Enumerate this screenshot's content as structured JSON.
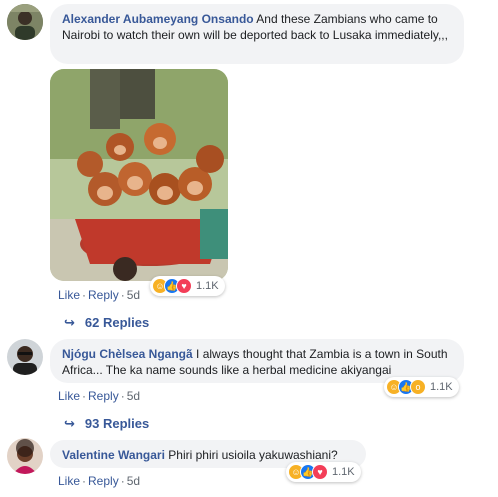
{
  "comments": [
    {
      "author": "Alexander Aubameyang Onsando",
      "text": "And these Zambians who came to Nairobi to watch their own will be deported back to Lusaka immediately,,,",
      "actions": {
        "like": "Like",
        "reply": "Reply",
        "time": "5d"
      },
      "reaction_count": "1.1K",
      "replies": "62 Replies"
    },
    {
      "author": "Njógu Chèlsea Ngangã",
      "text": "I always thought that Zambia is a town in South Africa... The ka name sounds like a herbal medicine akiyangai",
      "actions": {
        "like": "Like",
        "reply": "Reply",
        "time": "5d"
      },
      "reaction_count": "1.1K",
      "replies": "93 Replies"
    },
    {
      "author": "Valentine Wangari",
      "text": "Phiri phiri usioila yakuwashiani?",
      "actions": {
        "like": "Like",
        "reply": "Reply",
        "time": "5d"
      },
      "reaction_count": "1.1K"
    }
  ],
  "icons": {
    "haha": "haha-reaction-icon",
    "like": "like-reaction-icon",
    "love": "love-reaction-icon",
    "wow": "wow-reaction-icon",
    "reply_arrow": "reply-arrow-icon"
  }
}
